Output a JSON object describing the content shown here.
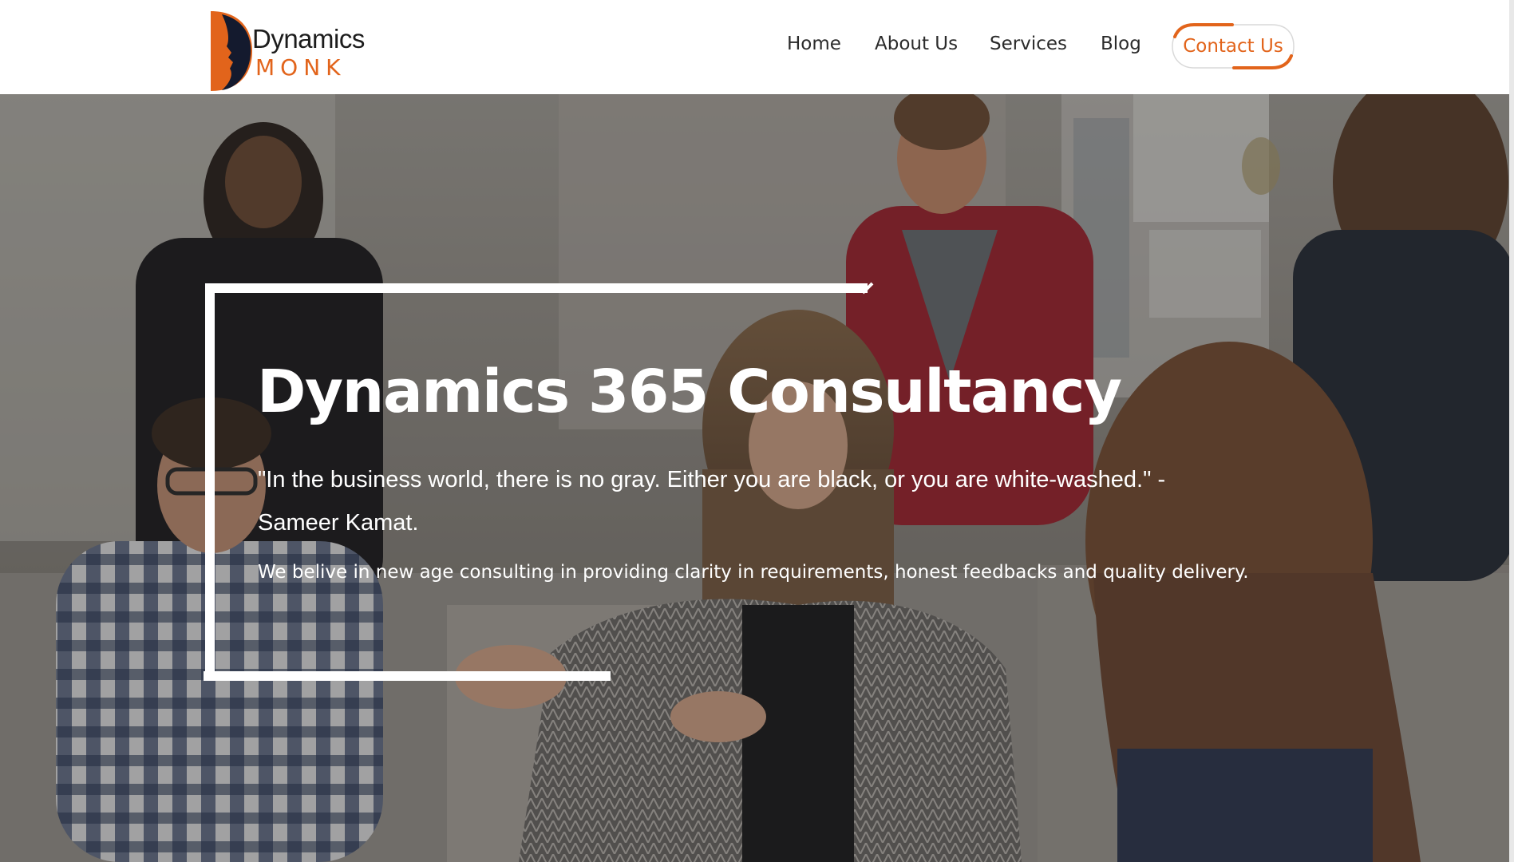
{
  "brand": {
    "logo_line1": "Dynamics",
    "logo_line2": "MONK",
    "logo_color_accent": "#e2641b",
    "logo_color_dark": "#1c1c1c"
  },
  "nav": {
    "items": [
      {
        "label": "Home"
      },
      {
        "label": "About Us"
      },
      {
        "label": "Services"
      },
      {
        "label": "Blog"
      }
    ],
    "contact_label": "Contact Us",
    "accent_color": "#e2641b"
  },
  "hero": {
    "title": "Dynamics 365 Consultancy",
    "quote": "\"In the business world, there is no gray. Either you are black, or you are white-washed.\" - Sameer Kamat.",
    "tagline": "We belive in new age consulting in providing clarity in requirements, honest feedbacks and quality delivery.",
    "text_color": "#ffffff"
  }
}
